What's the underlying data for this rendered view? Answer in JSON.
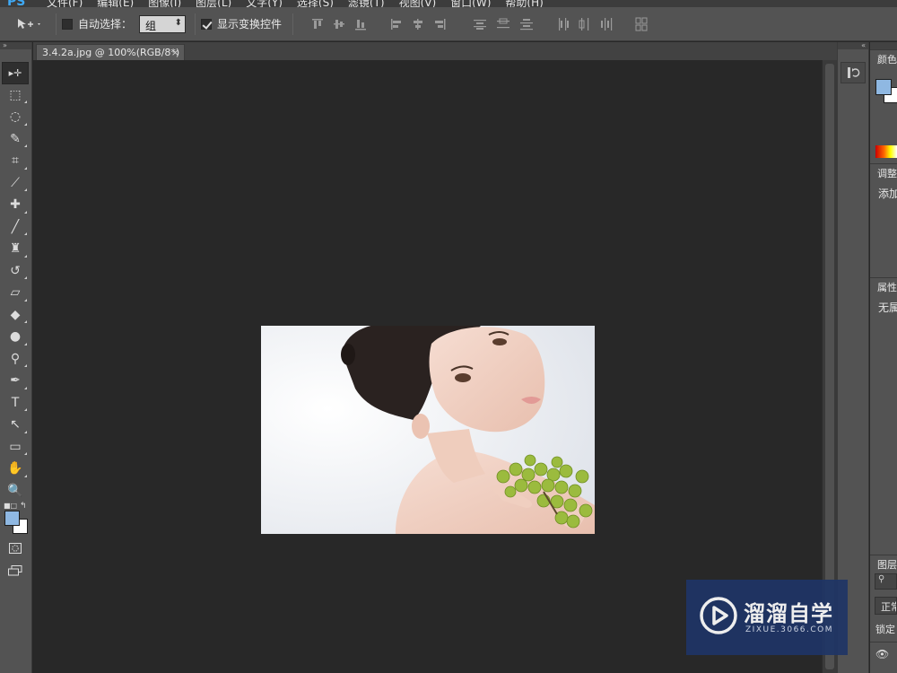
{
  "app": {
    "logo": "PS",
    "accent": "#3fa9f5"
  },
  "menu": [
    "文件(F)",
    "编辑(E)",
    "图像(I)",
    "图层(L)",
    "文字(Y)",
    "选择(S)",
    "滤镜(T)",
    "视图(V)",
    "窗口(W)",
    "帮助(H)"
  ],
  "options": {
    "auto_select_label": "自动选择：",
    "auto_select_checked": false,
    "auto_select_value": "组",
    "show_transform_label": "显示变换控件",
    "show_transform_checked": true
  },
  "document": {
    "tab_title": "3.4.2a.jpg @ 100%(RGB/8*)",
    "close": "×"
  },
  "tools": [
    "move-icon",
    "marquee-icon",
    "lasso-icon",
    "quick-select-icon",
    "crop-icon",
    "eyedropper-icon",
    "healing-icon",
    "brush-icon",
    "stamp-icon",
    "history-brush-icon",
    "eraser-icon",
    "bucket-icon",
    "blur-icon",
    "dodge-icon",
    "pen-icon",
    "type-icon",
    "path-select-icon",
    "rectangle-icon",
    "hand-icon",
    "zoom-icon"
  ],
  "tool_glyphs": [
    "▸✛",
    "⬚",
    "◌",
    "✎",
    "⌗",
    "⟋",
    "✚",
    "╱",
    "♜",
    "↺",
    "▱",
    "◆",
    "●",
    "⚲",
    "✒",
    "T",
    "↖",
    "▭",
    "✋",
    "🔍"
  ],
  "colors": {
    "foreground": "#8fb8e2",
    "background": "#ffffff"
  },
  "panels": {
    "color_title": "颜色",
    "adjust_title": "调整",
    "adjust_text": "添加",
    "props_title": "属性",
    "props_text": "无属",
    "layers_title": "图层",
    "layers_blend": "正常",
    "layers_lock": "锁定"
  },
  "watermark": {
    "title": "溜溜自学",
    "subtitle": "ZIXUE.3066.COM"
  }
}
